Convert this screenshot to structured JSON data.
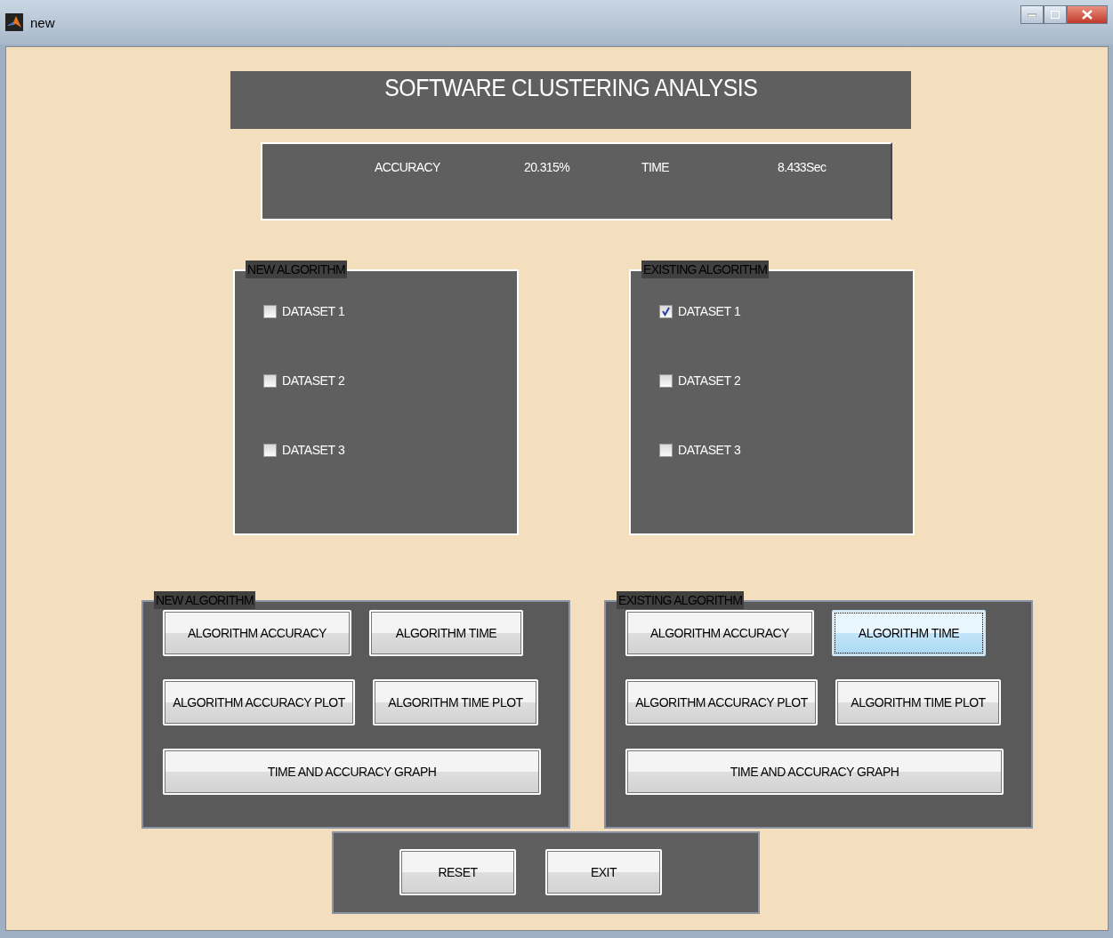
{
  "window": {
    "title": "new"
  },
  "title": "SOFTWARE CLUSTERING ANALYSIS",
  "stats": [
    {
      "label": "ACCURACY",
      "value": "20.315%"
    },
    {
      "label": "TIME",
      "value": "8.433Sec"
    }
  ],
  "dataset_panels": [
    {
      "title": "NEW ALGORITHM",
      "options": [
        {
          "label": "DATASET 1",
          "checked": false
        },
        {
          "label": "DATASET 2",
          "checked": false
        },
        {
          "label": "DATASET 3",
          "checked": false
        }
      ]
    },
    {
      "title": "EXISTING ALGORITHM",
      "options": [
        {
          "label": "DATASET 1",
          "checked": true
        },
        {
          "label": "DATASET 2",
          "checked": false
        },
        {
          "label": "DATASET 3",
          "checked": false
        }
      ]
    }
  ],
  "action_panels": [
    {
      "title": "NEW ALGORITHM",
      "rows": [
        [
          {
            "label": "ALGORITHM ACCURACY",
            "focused": false
          },
          {
            "label": "ALGORITHM TIME",
            "focused": false
          }
        ],
        [
          {
            "label": "ALGORITHM ACCURACY PLOT",
            "focused": false
          },
          {
            "label": "ALGORITHM TIME PLOT",
            "focused": false
          }
        ],
        [
          {
            "label": "TIME AND ACCURACY GRAPH",
            "focused": false
          }
        ]
      ]
    },
    {
      "title": "EXISTING ALGORITHM",
      "rows": [
        [
          {
            "label": "ALGORITHM ACCURACY",
            "focused": false
          },
          {
            "label": "ALGORITHM TIME",
            "focused": true
          }
        ],
        [
          {
            "label": "ALGORITHM ACCURACY PLOT",
            "focused": false
          },
          {
            "label": "ALGORITHM TIME PLOT",
            "focused": false
          }
        ],
        [
          {
            "label": "TIME AND ACCURACY GRAPH",
            "focused": false
          }
        ]
      ]
    }
  ],
  "footer_buttons": [
    "RESET",
    "EXIT"
  ]
}
